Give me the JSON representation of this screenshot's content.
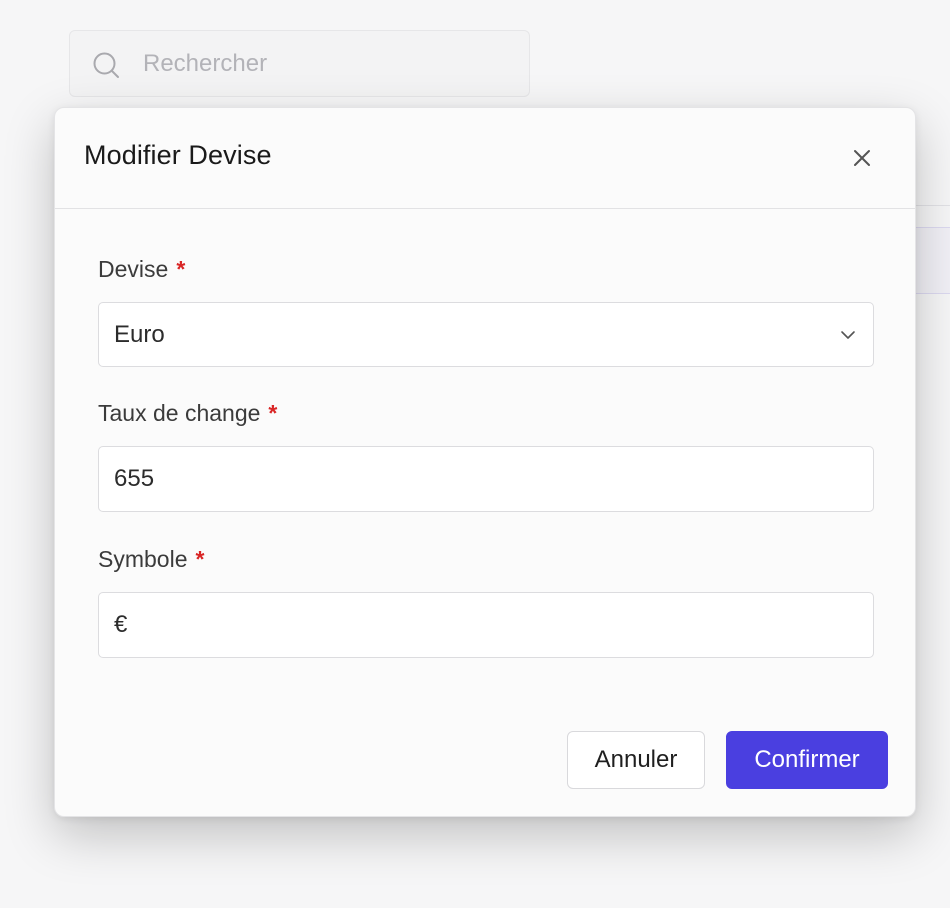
{
  "background": {
    "search": {
      "placeholder": "Rechercher"
    }
  },
  "modal": {
    "title": "Modifier Devise",
    "fields": [
      {
        "label": "Devise",
        "required_mark": "*",
        "value": "Euro",
        "type": "select"
      },
      {
        "label": "Taux de change",
        "required_mark": "*",
        "value": "655",
        "type": "text"
      },
      {
        "label": "Symbole",
        "required_mark": "*",
        "value": "€",
        "type": "text"
      }
    ],
    "buttons": {
      "cancel": "Annuler",
      "confirm": "Confirmer"
    }
  },
  "colors": {
    "accent": "#4a3fe0",
    "required": "#d92525"
  },
  "icons": {
    "search": "search-icon",
    "close": "close-icon",
    "chevron": "chevron-down-icon"
  }
}
